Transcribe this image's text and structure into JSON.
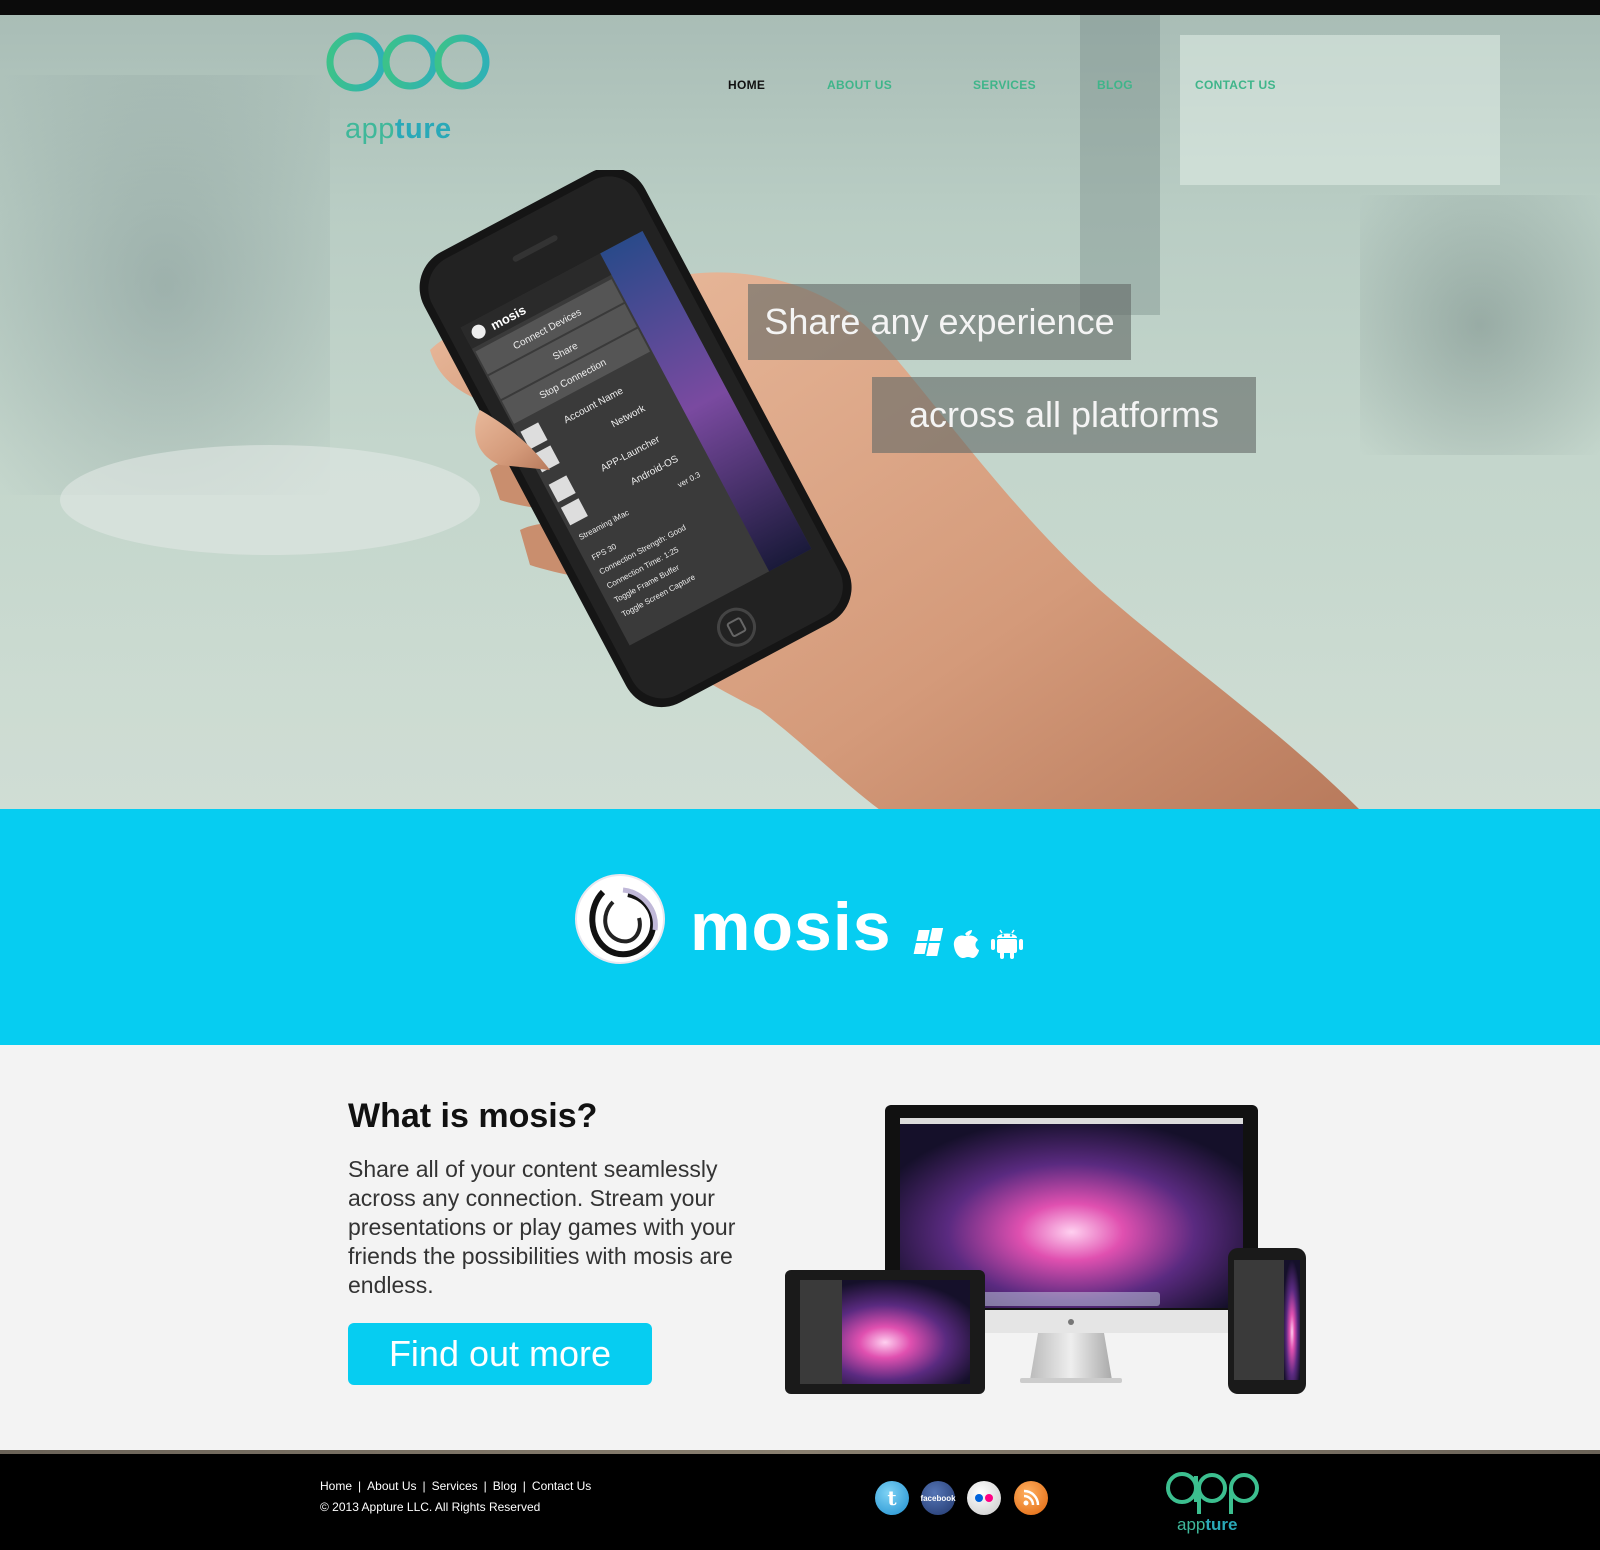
{
  "brand": {
    "name_light": "app",
    "name_bold": "ture",
    "logo_mark": "app"
  },
  "nav": {
    "items": [
      {
        "label": "HOME",
        "active": true
      },
      {
        "label": "ABOUT US",
        "active": false
      },
      {
        "label": "SERVICES",
        "active": false
      },
      {
        "label": "BLOG",
        "active": false
      },
      {
        "label": "CONTACT US",
        "active": false
      }
    ]
  },
  "hero": {
    "tagline_1": "Share any experience",
    "tagline_2": "across all platforms",
    "phone_app": {
      "app_name": "mosis",
      "menu": [
        "Connect Devices",
        "Share",
        "Stop Connection"
      ],
      "account": [
        "Account Name",
        "Network"
      ],
      "launcher": [
        "APP-Launcher",
        "Android-OS"
      ],
      "stream_header": "Streaming iMac",
      "version": "ver 0.3",
      "stats": [
        "FPS 30",
        "Connection Strength: Good",
        "Connection Time: 1:25",
        "Toggle Frame Buffer",
        "Toggle Screen Capture"
      ]
    }
  },
  "product": {
    "name": "mosis",
    "platform_icons": [
      "windows-icon",
      "apple-icon",
      "android-icon"
    ]
  },
  "about": {
    "heading": "What is mosis?",
    "description": "Share all of your content seamlessly across any connection. Stream your presentations or play games with your friends the possibilities with mosis are endless.",
    "cta_label": "Find out more"
  },
  "footer": {
    "links": [
      "Home",
      "About Us",
      "Services",
      "Blog",
      "Contact Us"
    ],
    "copyright": "© 2013 Appture LLC. All Rights Reserved",
    "social": [
      {
        "name": "twitter-icon",
        "label": "t",
        "color": "#2fa7e0"
      },
      {
        "name": "facebook-icon",
        "label": "facebook",
        "color": "#2c4a8e"
      },
      {
        "name": "flickr-icon",
        "label": "flickr",
        "color": "#e8e8e8"
      },
      {
        "name": "rss-icon",
        "label": "rss",
        "color": "#f07a16"
      }
    ]
  },
  "colors": {
    "accent": "#06cdf1",
    "brand_green": "#3fb89a",
    "nav_green": "#3fb58a",
    "content_bg": "#f3f3f3"
  }
}
